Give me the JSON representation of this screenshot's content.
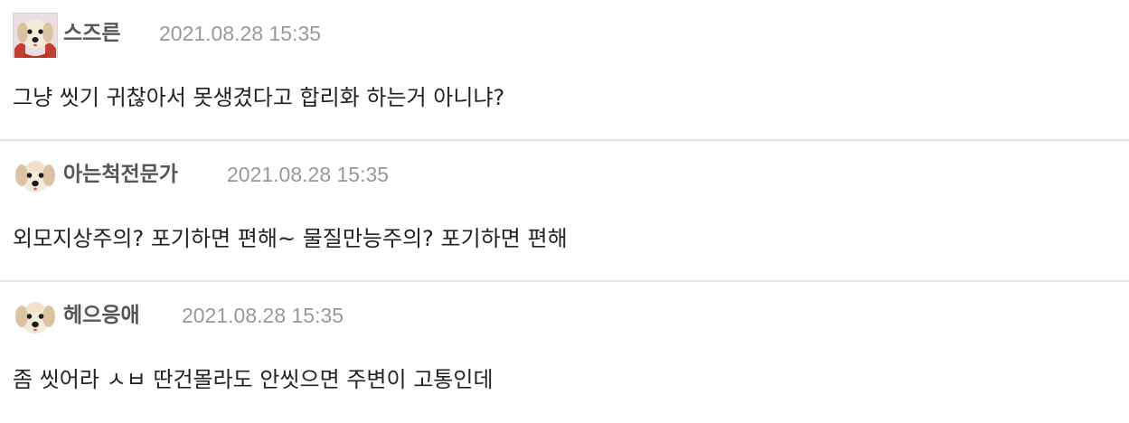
{
  "comments": [
    {
      "nickname": "스즈른",
      "timestamp": "2021.08.28 15:35",
      "text": "그냥 씻기 귀찮아서 못생겼다고 합리화 하는거 아니냐?",
      "avatar_icon": "puppy-with-red-scarf-icon"
    },
    {
      "nickname": "아는척전문가",
      "timestamp": "2021.08.28 15:35",
      "text": "외모지상주의? 포기하면 편해~ 물질만능주의? 포기하면 편해",
      "avatar_icon": "puppy-icon"
    },
    {
      "nickname": "헤으응애",
      "timestamp": "2021.08.28 15:35",
      "text": "좀 씻어라 ㅅㅂ 딴건몰라도 안씻으면 주변이 고통인데",
      "avatar_icon": "puppy-icon"
    }
  ]
}
